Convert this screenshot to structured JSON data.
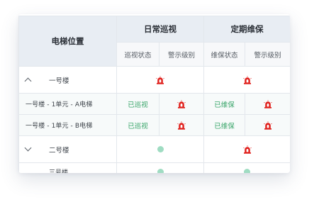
{
  "header": {
    "location": "电梯位置",
    "daily_patrol": "日常巡视",
    "periodic_maintenance": "定期维保",
    "patrol_status": "巡视状态",
    "warning_level_1": "警示级别",
    "maintenance_status": "维保状态",
    "warning_level_2": "警示级别"
  },
  "rows": [
    {
      "type": "group",
      "label": "一号楼",
      "expanded": true,
      "patrol_indicator": "siren-icon",
      "maintenance_indicator": "siren-icon"
    },
    {
      "type": "child",
      "label": "一号楼 - 1单元 - A电梯",
      "patrol_status": "已巡视",
      "patrol_warning": "siren-icon",
      "maintenance_status": "已维保",
      "maintenance_warning": "siren-icon"
    },
    {
      "type": "child",
      "label": "一号楼 - 1单元 - B电梯",
      "patrol_status": "已巡视",
      "patrol_warning": "siren-icon",
      "maintenance_status": "已维保",
      "maintenance_warning": "siren-icon"
    },
    {
      "type": "group",
      "label": "二号楼",
      "expanded": false,
      "patrol_indicator": "green-dot",
      "maintenance_indicator": "siren-icon"
    },
    {
      "type": "group",
      "label": "三号楼",
      "expanded": false,
      "patrol_indicator": "green-dot",
      "maintenance_indicator": "green-dot"
    }
  ],
  "colors": {
    "header_bg": "#e8edf3",
    "siren_red": "#e0201c",
    "status_green": "#3aa56a",
    "dot_green": "#9fdcc2"
  }
}
